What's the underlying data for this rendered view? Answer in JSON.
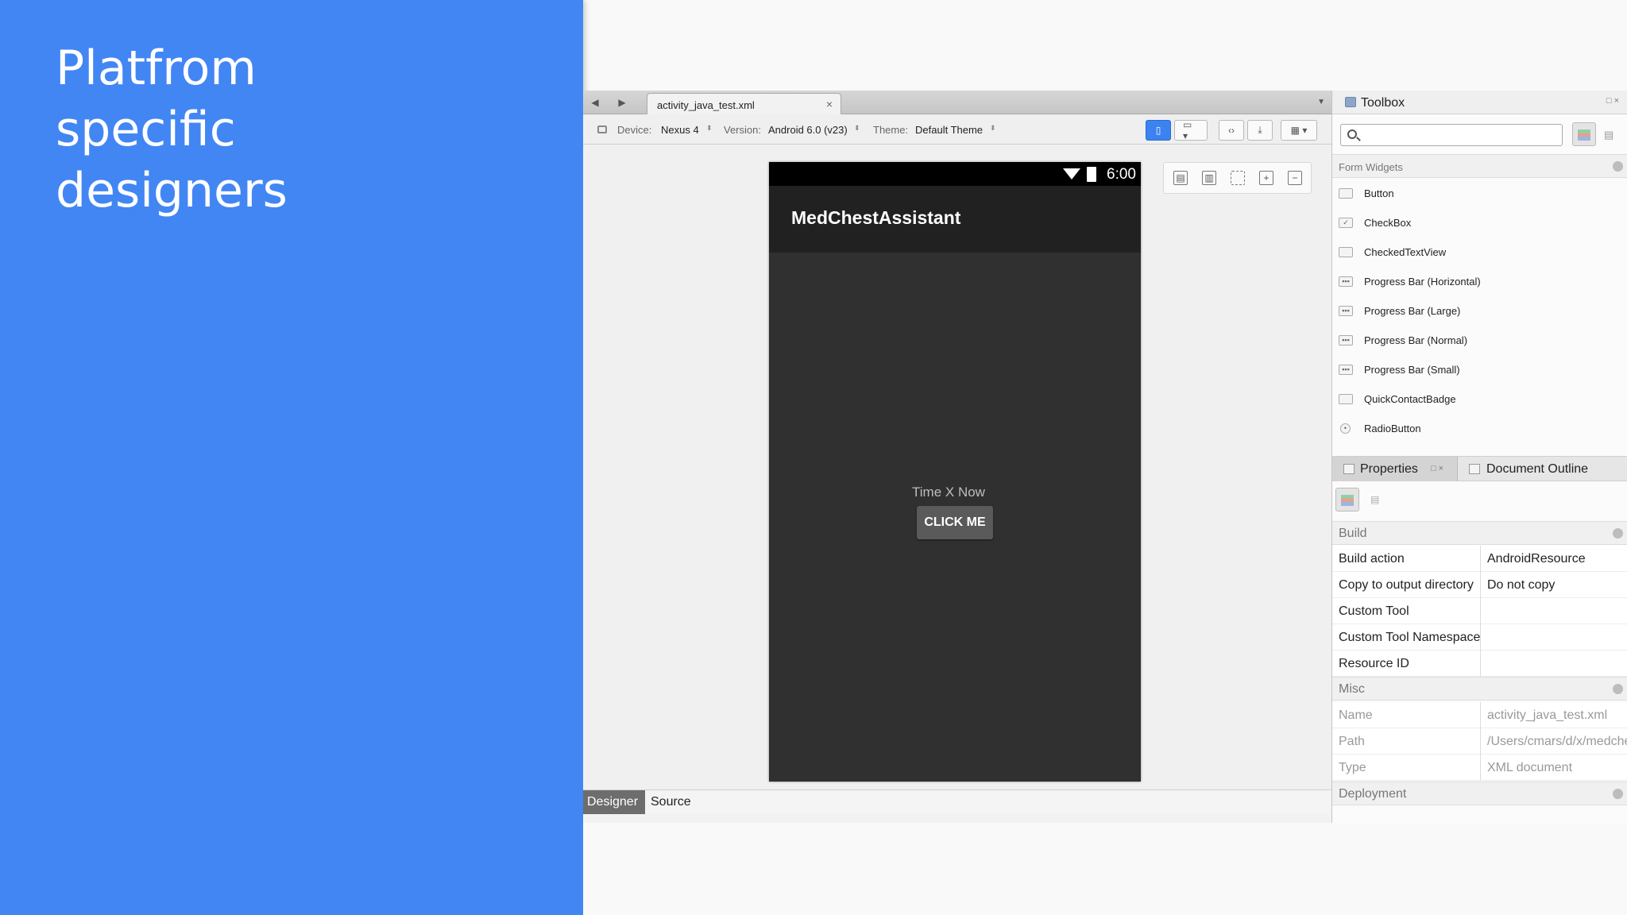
{
  "slide": {
    "title_lines": [
      "Platfrom",
      "specific",
      "designers"
    ]
  },
  "tabbar": {
    "tab_label": "activity_java_test.xml",
    "close_glyph": "×"
  },
  "devbar": {
    "device_label": "Device:",
    "device_value": "Nexus 4",
    "version_label": "Version:",
    "version_value": "Android 6.0 (v23)",
    "theme_label": "Theme:",
    "theme_value": "Default Theme"
  },
  "phone": {
    "time": "6:00",
    "app_title": "MedChestAssistant",
    "text_view": "Time X Now",
    "button_label": "CLICK ME"
  },
  "view_tabs": {
    "designer": "Designer",
    "source": "Source"
  },
  "toolbox": {
    "title": "Toolbox",
    "section": "Form Widgets",
    "items": [
      {
        "label": "Button",
        "icon": "button-icon"
      },
      {
        "label": "CheckBox",
        "icon": "checkbox-icon"
      },
      {
        "label": "CheckedTextView",
        "icon": "checked-text-view-icon"
      },
      {
        "label": "Progress Bar (Horizontal)",
        "icon": "progress-bar-icon"
      },
      {
        "label": "Progress Bar (Large)",
        "icon": "progress-bar-icon"
      },
      {
        "label": "Progress Bar (Normal)",
        "icon": "progress-bar-icon"
      },
      {
        "label": "Progress Bar (Small)",
        "icon": "progress-bar-icon"
      },
      {
        "label": "QuickContactBadge",
        "icon": "contact-badge-icon"
      },
      {
        "label": "RadioButton",
        "icon": "radio-icon"
      }
    ]
  },
  "properties": {
    "tab_properties": "Properties",
    "tab_outline": "Document Outline",
    "sections": [
      {
        "title": "Build",
        "rows": [
          {
            "name": "Build action",
            "value": "AndroidResource"
          },
          {
            "name": "Copy to output directory",
            "value": "Do not copy"
          },
          {
            "name": "Custom Tool",
            "value": ""
          },
          {
            "name": "Custom Tool Namespace",
            "value": ""
          },
          {
            "name": "Resource ID",
            "value": ""
          }
        ]
      },
      {
        "title": "Misc",
        "rows": [
          {
            "name": "Name",
            "value": "activity_java_test.xml"
          },
          {
            "name": "Path",
            "value": "/Users/cmars/d/x/medchest"
          },
          {
            "name": "Type",
            "value": "XML document"
          }
        ]
      },
      {
        "title": "Deployment",
        "rows": []
      }
    ]
  },
  "colors": {
    "slide_bg": "#4286f4",
    "accent": "#3c82f0",
    "phone_bg": "#303030",
    "app_bar": "#212121"
  }
}
